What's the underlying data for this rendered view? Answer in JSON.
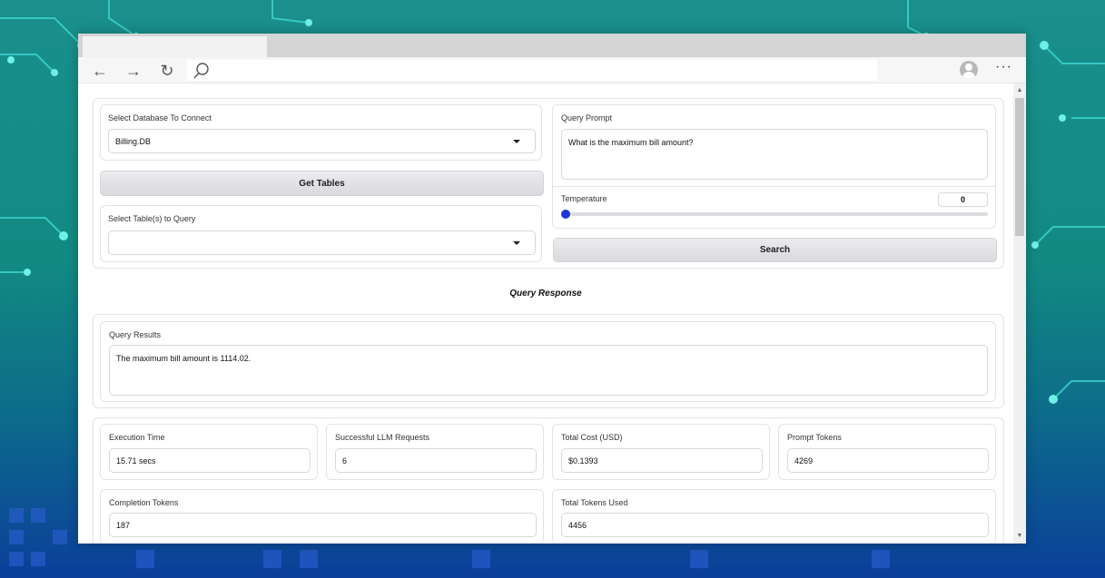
{
  "browser": {
    "icons": {
      "back": "back-arrow-icon",
      "forward": "forward-arrow-icon",
      "refresh": "refresh-icon",
      "search": "search-icon",
      "profile": "profile-icon",
      "more": "more-icon"
    },
    "more_glyph": "···"
  },
  "db": {
    "label": "Select Database To Connect",
    "value": "Billing.DB",
    "get_tables_label": "Get Tables",
    "tables_label": "Select Table(s) to Query",
    "tables_value": ""
  },
  "query": {
    "prompt_label": "Query Prompt",
    "prompt_value": "What is the maximum bill amount?",
    "temperature_label": "Temperature",
    "temperature_value": "0",
    "search_label": "Search",
    "accent_color": "#1c36d9"
  },
  "response": {
    "heading": "Query Response",
    "results_label": "Query Results",
    "results_value": "The maximum bill amount is 1114.02."
  },
  "stats": {
    "execution_time_label": "Execution Time",
    "execution_time_value": "15.71 secs",
    "llm_requests_label": "Successful LLM Requests",
    "llm_requests_value": "6",
    "total_cost_label": "Total Cost (USD)",
    "total_cost_value": "$0.1393",
    "prompt_tokens_label": "Prompt Tokens",
    "prompt_tokens_value": "4269",
    "completion_tokens_label": "Completion Tokens",
    "completion_tokens_value": "187",
    "total_tokens_label": "Total Tokens Used",
    "total_tokens_value": "4456"
  }
}
